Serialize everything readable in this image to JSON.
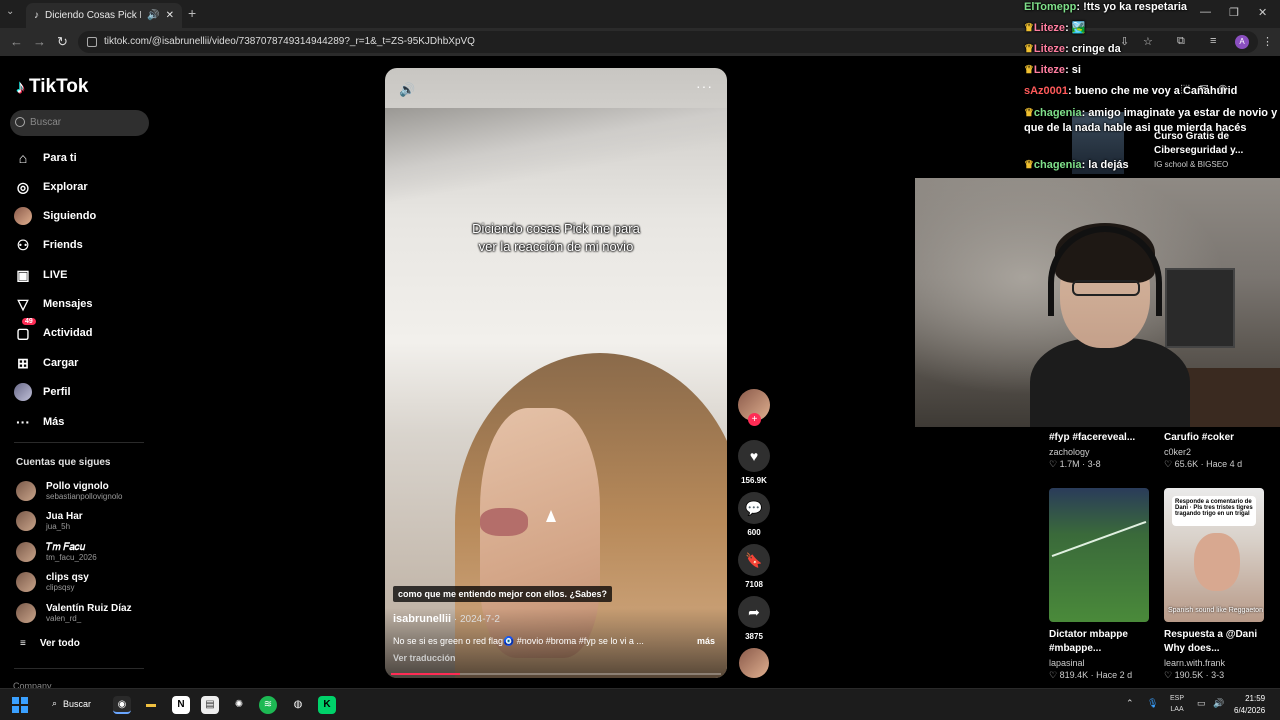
{
  "browser": {
    "tab_title": "Diciendo Cosas Pick Me: N",
    "url": "tiktok.com/@isabrunellii/video/7387078749314944289?_r=1&_t=ZS-95KJDhbXpVQ"
  },
  "sidebar": {
    "logo": "TikTok",
    "search_placeholder": "Buscar",
    "nav": [
      {
        "label": "Para ti",
        "icon": "home-icon"
      },
      {
        "label": "Explorar",
        "icon": "compass-icon"
      },
      {
        "label": "Siguiendo",
        "icon": "avatar-icon"
      },
      {
        "label": "Friends",
        "icon": "friends-icon"
      },
      {
        "label": "LIVE",
        "icon": "live-icon"
      },
      {
        "label": "Mensajes",
        "icon": "paper-plane-icon"
      },
      {
        "label": "Actividad",
        "icon": "bell-icon",
        "badge": "49"
      },
      {
        "label": "Cargar",
        "icon": "upload-icon"
      },
      {
        "label": "Perfil",
        "icon": "profile-icon"
      },
      {
        "label": "Más",
        "icon": "more-icon"
      }
    ],
    "following_title": "Cuentas que sigues",
    "following": [
      {
        "name": "Pollo vignolo",
        "handle": "sebastianpollovignolo"
      },
      {
        "name": "Jua Har",
        "handle": "jua_5h"
      },
      {
        "name": "𝑇𝑚 𝐹𝑎𝑐𝑢",
        "handle": "tm_facu_2026"
      },
      {
        "name": "clips qsy",
        "handle": "clipsqsy"
      },
      {
        "name": "Valentín Ruiz Díaz",
        "handle": "valen_rd_"
      }
    ],
    "see_all": "Ver todo",
    "company": "Company"
  },
  "video": {
    "caption_line1": "Diciendo cosas Pick me para",
    "caption_line2": "ver la reacción de mi novio",
    "subtitle": "como que me entiendo mejor con ellos. ¿Sabes?",
    "author": "isabrunellii",
    "date": " · 2024-7-2",
    "description": "No se si es green o red flag🧿 #novio #broma #fyp  se lo vi a ...",
    "more": "más",
    "translate": "Ver traducción",
    "progress": 0.21
  },
  "actions": {
    "likes": "156.9K",
    "comments": "600",
    "saves": "7108",
    "shares": "3875"
  },
  "chat": [
    {
      "user": "ElTomepp",
      "msg": "!tts yo ka respetaria",
      "crown": false
    },
    {
      "user": "Liteze",
      "msg": "🏞️",
      "crown": true
    },
    {
      "user": "Liteze",
      "msg": "cringe da",
      "crown": true
    },
    {
      "user": "Liteze",
      "msg": "si",
      "crown": true
    },
    {
      "user": "sAz0001",
      "msg": "bueno che me voy a Cañahurid",
      "crown": false
    },
    {
      "user": "chagenia",
      "msg": "amigo imaginate ya estar de novio y que de la nada hable asi que mierda hacés",
      "crown": true
    },
    {
      "user": "chagenia",
      "msg": "la dejás",
      "crown": true
    }
  ],
  "ad": {
    "title": "Curso Gratis de Ciberseguridad y...",
    "sub": "IG school & BIGSEO"
  },
  "recommendations": [
    {
      "title": "#fyp #facereveal...",
      "author": "zachology",
      "stats": "♡ 1.7M · 3-8"
    },
    {
      "title": "Carufio #coker",
      "author": "c0ker2",
      "stats": "♡ 65.6K · Hace 4 d"
    },
    {
      "title": "Dictator mbappe #mbappe...",
      "author": "lapasinal",
      "stats": "♡ 819.4K · Hace 2 d"
    },
    {
      "title": "Respuesta a @Dani Why does...",
      "author": "learn.with.frank",
      "stats": "♡ 190.5K · 3-3"
    }
  ],
  "rec_thumb2": {
    "bubble": "Responde a comentario de Dani · Pls tres tristes tigres tragando trigo en un trigal",
    "caption": "Spanish sound like Reggaeton"
  },
  "taskbar": {
    "search": "Buscar",
    "lang": "ESP",
    "lang2": "LAA",
    "time": "21:59",
    "date": "6/4/2026"
  }
}
